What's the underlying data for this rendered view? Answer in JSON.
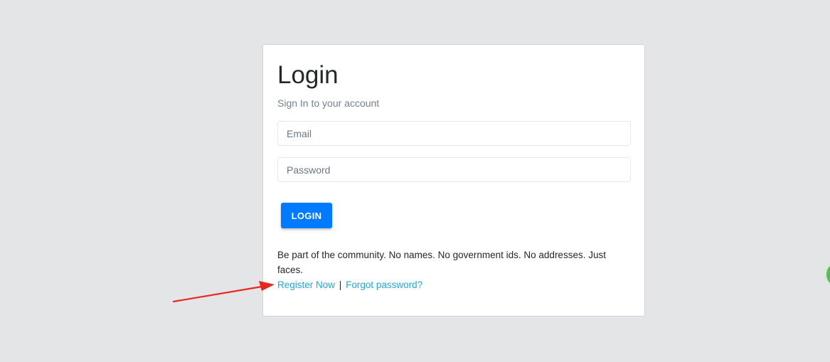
{
  "login": {
    "title": "Login",
    "subtitle": "Sign In to your account",
    "email_placeholder": "Email",
    "password_placeholder": "Password",
    "login_button": "LOGIN",
    "blurb": "Be part of the community. No names. No government ids. No addresses. Just faces.",
    "register_link": "Register Now",
    "separator": "|",
    "forgot_link": "Forgot password?"
  },
  "colors": {
    "background": "#e4e5e7",
    "primary_button": "#007bff",
    "link": "#20a8d8",
    "annotation_arrow": "#e8281e",
    "edge_badge": "#5cb85c"
  },
  "icons": {
    "annotation": "red-arrow-icon",
    "edge_widget": "green-circle-icon"
  }
}
